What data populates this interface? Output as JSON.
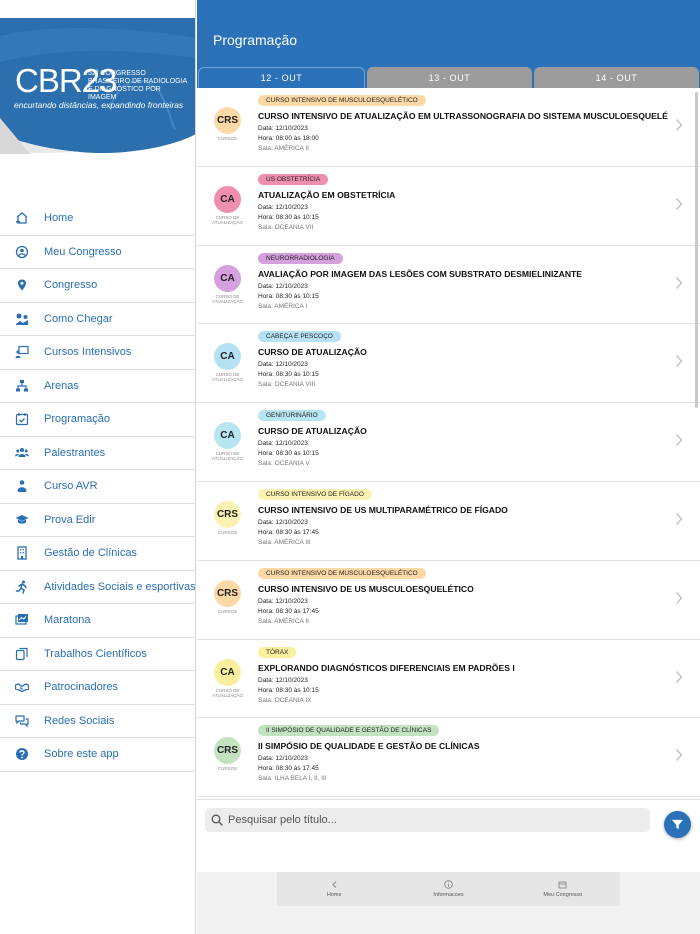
{
  "sidebar": {
    "logo": {
      "main": "CBR23",
      "subtitle": "52º CONGRESSO BRASILEIRO DE RADIOLOGIA E DIAGNÓSTICO POR IMAGEM",
      "tagline": "encurtando distâncias, expandindo fronteiras"
    },
    "items": [
      {
        "label": "Home",
        "icon": "home-icon"
      },
      {
        "label": "Meu Congresso",
        "icon": "user-circle-icon"
      },
      {
        "label": "Congresso",
        "icon": "map-pin-icon"
      },
      {
        "label": "Como Chegar",
        "icon": "map-route-icon"
      },
      {
        "label": "Cursos Intensivos",
        "icon": "presentation-icon"
      },
      {
        "label": "Arenas",
        "icon": "network-icon"
      },
      {
        "label": "Programação",
        "icon": "calendar-check-icon"
      },
      {
        "label": "Palestrantes",
        "icon": "people-icon"
      },
      {
        "label": "Curso AVR",
        "icon": "person-presenter-icon"
      },
      {
        "label": "Prova Edir",
        "icon": "graduation-cap-icon"
      },
      {
        "label": "Gestão de Clínicas",
        "icon": "building-icon"
      },
      {
        "label": "Atividades Sociais e esportivas",
        "icon": "running-icon"
      },
      {
        "label": "Maratona",
        "icon": "map-icon"
      },
      {
        "label": "Trabalhos Científicos",
        "icon": "copy-icon"
      },
      {
        "label": "Patrocinadores",
        "icon": "handshake-icon"
      },
      {
        "label": "Redes Sociais",
        "icon": "chat-icon"
      },
      {
        "label": "Sobre este app",
        "icon": "question-icon"
      }
    ]
  },
  "header": {
    "title": "Programação"
  },
  "tabs": [
    {
      "label": "12 - OUT",
      "active": true
    },
    {
      "label": "13 - OUT",
      "active": false
    },
    {
      "label": "14 - OUT",
      "active": false
    }
  ],
  "sessions": [
    {
      "badge": "CURSO INTENSIVO DE MUSCULOESQUELÉTICO",
      "badge_color": "#fcd9a6",
      "avatar": "CRS",
      "avatar_color": "#fcd9a6",
      "caption": "CURSOS",
      "title": "CURSO INTENSIVO DE ATUALIZAÇÃO EM ULTRASSONOGRAFIA DO SISTEMA MUSCULOESQUELÉTICO",
      "date": "Data: 12/10/2023",
      "time": "Hora: 08:00 às 18:00",
      "room": "Sala: AMÉRICA II"
    },
    {
      "badge": "US OBSTETRÍCIA",
      "badge_color": "#ef8fb0",
      "avatar": "CA",
      "avatar_color": "#ef8fb0",
      "caption": "CURSO DE ATUALIZAÇÃO",
      "title": "ATUALIZAÇÃO EM OBSTETRÍCIA",
      "date": "Data: 12/10/2023",
      "time": "Hora: 08:30 às 10:15",
      "room": "Sala: OCEANIA VII"
    },
    {
      "badge": "NEURORRADIOLOGIA",
      "badge_color": "#d4a0dd",
      "avatar": "CA",
      "avatar_color": "#d4a0dd",
      "caption": "CURSO DE ATUALIZAÇÃO",
      "title": "AVALIAÇÃO POR IMAGEM DAS LESÕES COM SUBSTRATO DESMIELINIZANTE",
      "date": "Data: 12/10/2023",
      "time": "Hora: 08:30 às 10:15",
      "room": "Sala: AMÉRICA I"
    },
    {
      "badge": "CABEÇA E PESCOÇO",
      "badge_color": "#b5e1f4",
      "avatar": "CA",
      "avatar_color": "#b5e1f4",
      "caption": "CURSO DE ATUALIZAÇÃO",
      "title": "CURSO DE ATUALIZAÇÃO",
      "date": "Data: 12/10/2023",
      "time": "Hora: 08:30 às 10:15",
      "room": "Sala: OCEANIA VIII"
    },
    {
      "badge": "GENITURINÁRIO",
      "badge_color": "#b8e5f2",
      "avatar": "CA",
      "avatar_color": "#b8e5f2",
      "caption": "CURSO DE ATUALIZAÇÃO",
      "title": "CURSO DE ATUALIZAÇÃO",
      "date": "Data: 12/10/2023",
      "time": "Hora: 08:30 às 10:15",
      "room": "Sala: OCEANIA V"
    },
    {
      "badge": "CURSO INTENSIVO DE FÍGADO",
      "badge_color": "#fbf2b3",
      "avatar": "CRS",
      "avatar_color": "#fbf2b3",
      "caption": "CURSOS",
      "title": "CURSO INTENSIVO DE US MULTIPARAMÉTRICO DE FÍGADO",
      "date": "Data: 12/10/2023",
      "time": "Hora: 08:30 às 17:45",
      "room": "Sala: AMÉRICA III"
    },
    {
      "badge": "CURSO INTENSIVO DE MUSCULOESQUELÉTICO",
      "badge_color": "#fcd9a6",
      "avatar": "CRS",
      "avatar_color": "#fcd9a6",
      "caption": "CURSOS",
      "title": "CURSO INTENSIVO DE US MUSCULOESQUELÉTICO",
      "date": "Data: 12/10/2023",
      "time": "Hora: 08:30 às 17:45",
      "room": "Sala: AMÉRICA II"
    },
    {
      "badge": "TÓRAX",
      "badge_color": "#f9ef9c",
      "avatar": "CA",
      "avatar_color": "#f9ef9c",
      "caption": "CURSO DE ATUALIZAÇÃO",
      "title": "EXPLORANDO DIAGNÓSTICOS DIFERENCIAIS EM PADRÕES I",
      "date": "Data: 12/10/2023",
      "time": "Hora: 08:30 às 10:15",
      "room": "Sala: OCEANIA IX"
    },
    {
      "badge": "II SIMPÓSIO DE QUALIDADE E GESTÃO DE CLÍNICAS",
      "badge_color": "#c3e3c0",
      "avatar": "CRS",
      "avatar_color": "#c3e3c0",
      "caption": "CURSOS",
      "title": "II SIMPÓSIO DE QUALIDADE E GESTÃO DE CLÍNICAS",
      "date": "Data: 12/10/2023",
      "time": "Hora: 08:30 às 17:45",
      "room": "Sala: ILHA BELA I, II, III"
    },
    {
      "badge": "",
      "badge_color": "#7fcfc4",
      "avatar": "",
      "avatar_color": "#ffffff",
      "caption": "",
      "title": "",
      "date": "",
      "time": "",
      "room": ""
    }
  ],
  "search": {
    "placeholder": "Pesquisar pelo título..."
  },
  "bottom_nav": [
    {
      "label": "Home",
      "icon": "chevron-left-icon"
    },
    {
      "label": "Informacoes",
      "icon": "info-icon"
    },
    {
      "label": "Meu Congresso",
      "icon": "congress-icon"
    }
  ],
  "colors": {
    "primary": "#2a71b8",
    "tab_inactive": "#9c9c9c",
    "nav_text": "#2a6fb5"
  }
}
